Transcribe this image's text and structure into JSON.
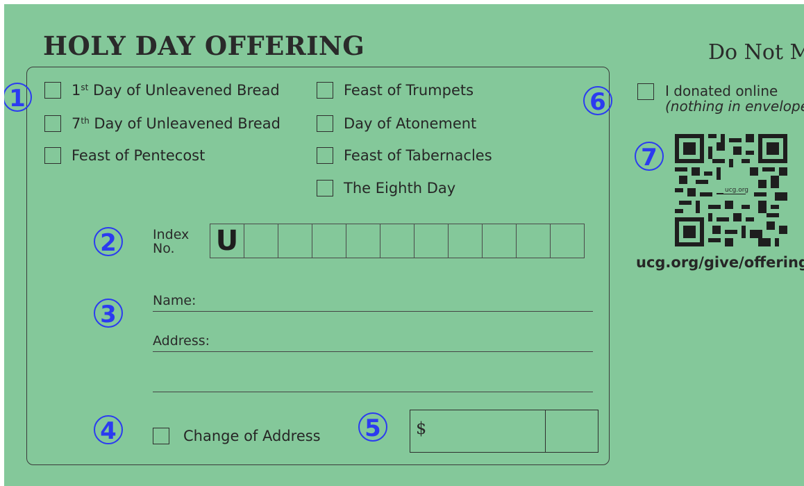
{
  "header": {
    "title": "HOLY DAY OFFERING",
    "do_not_mail": "Do Not Mail"
  },
  "markers": [
    "1",
    "2",
    "3",
    "4",
    "5",
    "6",
    "7"
  ],
  "holy_days_left": [
    {
      "sup": "st",
      "pre": "1",
      "label": " Day of Unleavened Bread",
      "checked": false
    },
    {
      "sup": "th",
      "pre": "7",
      "label": " Day of Unleavened Bread",
      "checked": false
    },
    {
      "sup": "",
      "pre": "",
      "label": "Feast of Pentecost",
      "checked": false
    }
  ],
  "holy_days_right": [
    {
      "label": "Feast of Trumpets",
      "checked": false
    },
    {
      "label": "Day of Atonement",
      "checked": false
    },
    {
      "label": "Feast of Tabernacles",
      "checked": false
    },
    {
      "label": "The Eighth Day",
      "checked": false
    }
  ],
  "index": {
    "label_line1": "Index",
    "label_line2": "No.",
    "prefix": "U",
    "empty_boxes": 10
  },
  "contact": {
    "name_label": "Name:",
    "address_label": "Address:"
  },
  "change_of_address": {
    "label": "Change of Address",
    "checked": false
  },
  "amount": {
    "currency": "$"
  },
  "online": {
    "line1": "I donated online",
    "line2": "(nothing in envelope)",
    "checked": false
  },
  "qr": {
    "center_label": "ucg.org"
  },
  "url": "ucg.org/give/offerings",
  "colors": {
    "background": "#84c89a",
    "marker": "#2b3bf0",
    "ink": "#2a2a2a"
  }
}
